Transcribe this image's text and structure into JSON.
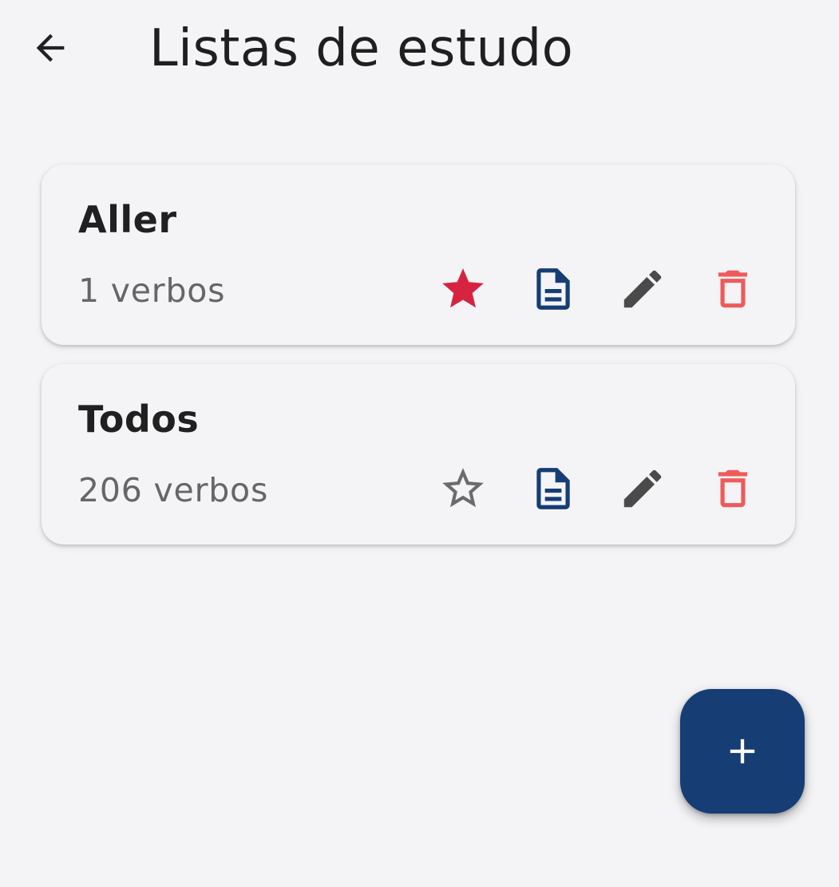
{
  "app_bar": {
    "back_icon": "arrow-back-icon",
    "title": "Listas de estudo"
  },
  "lists": [
    {
      "name": "Aller",
      "count": "1 verbos",
      "favorite": true
    },
    {
      "name": "Todos",
      "count": "206 verbos",
      "favorite": false
    }
  ],
  "icons": {
    "favorite_filled": "star-filled-icon",
    "favorite_empty": "star-outline-icon",
    "document": "document-icon",
    "edit": "pencil-icon",
    "delete": "trash-icon",
    "add": "plus-icon"
  },
  "colors": {
    "background": "#f4f4f7",
    "favorite_active": "#d62440",
    "favorite_inactive": "#6b6b6b",
    "document": "#163d74",
    "edit": "#4a4a4a",
    "delete": "#f05a5a",
    "fab": "#163d74"
  }
}
